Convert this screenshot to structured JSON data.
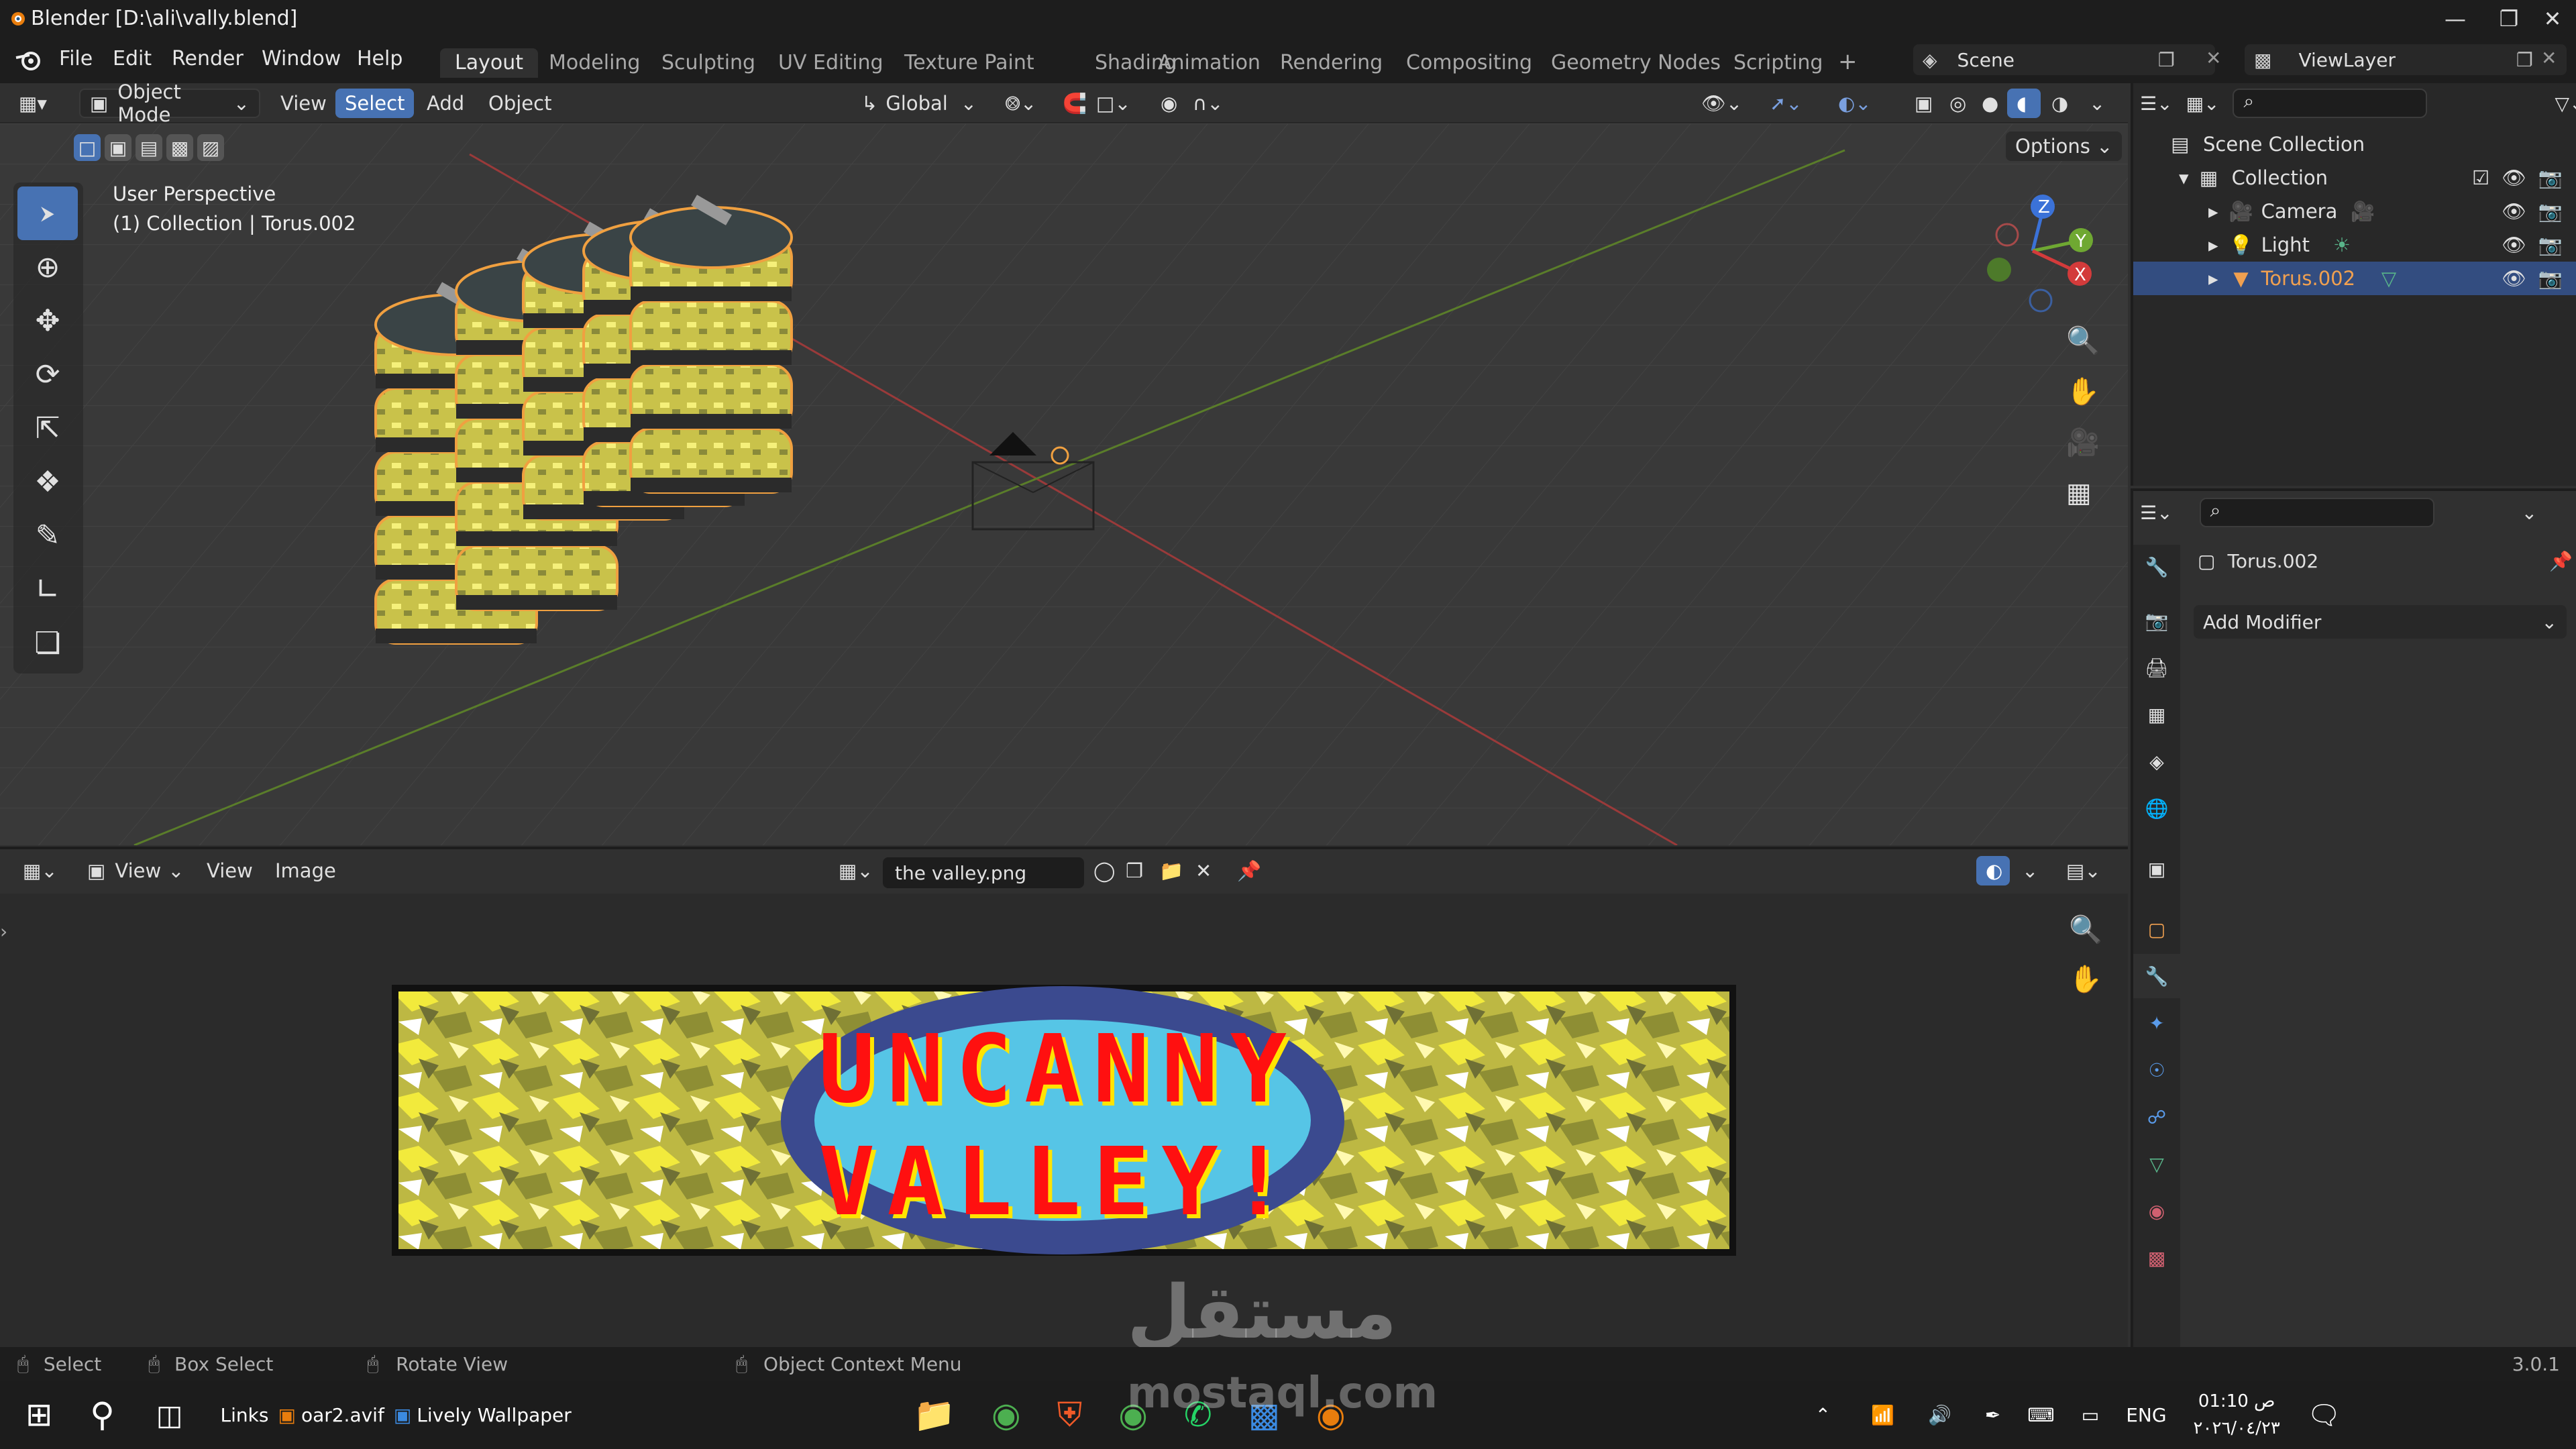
{
  "app": {
    "title": "Blender [D:\\ali\\vally.blend]",
    "version": "3.0.1"
  },
  "menu": {
    "items": [
      "File",
      "Edit",
      "Render",
      "Window",
      "Help"
    ]
  },
  "workspaces": {
    "tabs": [
      "Layout",
      "Modeling",
      "Sculpting",
      "UV Editing",
      "Texture Paint",
      "Shading",
      "Animation",
      "Rendering",
      "Compositing",
      "Geometry Nodes",
      "Scripting"
    ],
    "active": "Layout"
  },
  "scene": {
    "label": "Scene"
  },
  "viewlayer": {
    "label": "ViewLayer"
  },
  "viewport": {
    "mode": "Object Mode",
    "menus": [
      "View",
      "Select",
      "Add",
      "Object"
    ],
    "active_menu": "Select",
    "transform_orientation": "Global",
    "options_label": "Options",
    "overlay_line1": "User Perspective",
    "overlay_line2": "(1) Collection | Torus.002",
    "gizmo": {
      "x": "X",
      "y": "Y",
      "z": "Z"
    }
  },
  "image_editor": {
    "view_label": "View",
    "menus": [
      "View",
      "Image"
    ],
    "image_name": "the valley.png",
    "texture_line1": "UNCANNY",
    "texture_line2": "VALLEY!"
  },
  "outliner": {
    "scene_collection": "Scene Collection",
    "collection": "Collection",
    "items": [
      {
        "label": "Camera",
        "color": "#e6a24b"
      },
      {
        "label": "Light",
        "color": "#e6a24b"
      },
      {
        "label": "Torus.002",
        "color": "#f0a050"
      }
    ]
  },
  "properties": {
    "object_name": "Torus.002",
    "add_modifier": "Add Modifier"
  },
  "statusbar": {
    "select": "Select",
    "box_select": "Box Select",
    "rotate_view": "Rotate View",
    "context_menu": "Object Context Menu"
  },
  "taskbar": {
    "links_label": "Links",
    "pinned1": "oar2.avif",
    "pinned2": "Lively Wallpaper",
    "language": "ENG",
    "time": "01:10 ص",
    "date": "٢٠٢٦/٠٤/٢٣",
    "watermark1": "مستقل",
    "watermark2": "mostaql.com"
  },
  "colors": {
    "accent": "#4772b3",
    "selected_outline": "#f0a040",
    "grid_red": "#9a3a3a",
    "grid_green": "#5a7d2a"
  }
}
